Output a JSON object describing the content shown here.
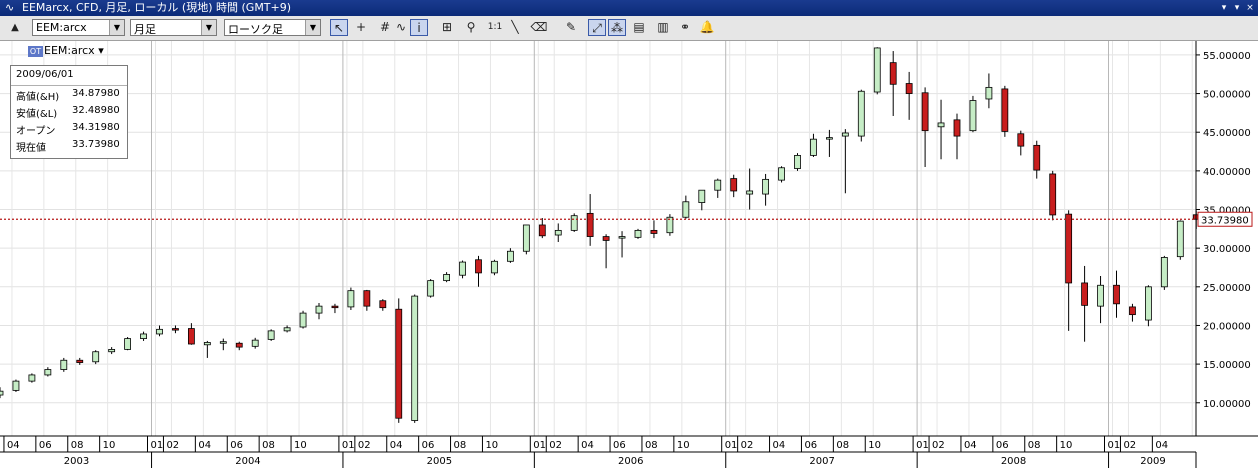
{
  "window": {
    "title": "EEMarcx, CFD, 月足, ローカル (現地) 時間 (GMT+9)",
    "controls": [
      "▾",
      "▾",
      "×"
    ]
  },
  "toolbar": {
    "symbol_combo": "EEM:arcx",
    "timeframe_combo": "月足",
    "charttype_combo": "ローソク足",
    "tools": [
      {
        "name": "cursor-tool-button",
        "glyph": "↖",
        "active": true
      },
      {
        "name": "crosshair-tool-button",
        "glyph": "+",
        "active": false
      },
      {
        "name": "grid-tool-button",
        "glyph": "#",
        "active": false
      },
      {
        "name": "indicator-tool-button",
        "glyph": "∿",
        "active": false
      },
      {
        "name": "info-tool-button",
        "glyph": "i",
        "active": true
      },
      {
        "name": "data-window-button",
        "glyph": "⊞",
        "active": false
      },
      {
        "name": "zoom-tool-button",
        "glyph": "⚲",
        "active": false
      },
      {
        "name": "zoom-reset-button",
        "glyph": "1:1",
        "active": false
      },
      {
        "name": "line-tool-button",
        "glyph": "╲",
        "active": false
      },
      {
        "name": "eraser-tool-button",
        "glyph": "⌫",
        "active": false
      },
      {
        "name": "erase-all-button",
        "glyph": "✎",
        "active": false
      },
      {
        "name": "autoscale-button",
        "glyph": "⤢",
        "active": true
      },
      {
        "name": "compare-button",
        "glyph": "⁂",
        "active": true
      },
      {
        "name": "template-button",
        "glyph": "▤",
        "active": false
      },
      {
        "name": "export-button",
        "glyph": "▥",
        "active": false
      },
      {
        "name": "link-button",
        "glyph": "⚭",
        "active": false
      },
      {
        "name": "alert-button",
        "glyph": "🔔",
        "active": false
      }
    ]
  },
  "symbol_tag": "EEM:arcx",
  "info_box": {
    "date": "2009/06/01",
    "rows": [
      {
        "key": "高値(&H)",
        "value": "34.87980"
      },
      {
        "key": "安値(&L)",
        "value": "32.48980"
      },
      {
        "key": "オープン",
        "value": "34.31980"
      },
      {
        "key": "現在値",
        "value": "33.73980"
      }
    ]
  },
  "chart_data": {
    "type": "candlestick",
    "yticks": [
      "55.00000",
      "50.00000",
      "45.00000",
      "40.00000",
      "35.00000",
      "30.00000",
      "25.00000",
      "20.00000",
      "15.00000",
      "10.00000"
    ],
    "ytick_values": [
      55,
      50,
      45,
      40,
      35,
      30,
      25,
      20,
      15,
      10
    ],
    "ylim": [
      5.7,
      56.8
    ],
    "current_price": 33.7398,
    "current_price_label": "33.73980",
    "month_labels": [
      "04",
      "06",
      "08",
      "10",
      "01",
      "02",
      "04",
      "06",
      "08",
      "10",
      "01",
      "02",
      "04",
      "06",
      "08",
      "10",
      "01",
      "02",
      "04",
      "06",
      "08",
      "10",
      "01",
      "02",
      "04",
      "06",
      "08",
      "10",
      "01",
      "02",
      "04",
      "06",
      "08",
      "10",
      "01",
      "02",
      "04"
    ],
    "year_labels": [
      "2003",
      "2004",
      "2005",
      "2006",
      "2007",
      "2008",
      "2009"
    ],
    "up_color": "#c6edc6",
    "down_color": "#c81e1e",
    "dates": [
      "2003-03",
      "2003-04",
      "2003-05",
      "2003-06",
      "2003-07",
      "2003-08",
      "2003-09",
      "2003-10",
      "2003-11",
      "2003-12",
      "2004-01",
      "2004-02",
      "2004-03",
      "2004-04",
      "2004-05",
      "2004-06",
      "2004-07",
      "2004-08",
      "2004-09",
      "2004-10",
      "2004-11",
      "2004-12",
      "2005-01",
      "2005-02",
      "2005-03",
      "2005-04",
      "2005-05",
      "2005-06",
      "2005-07",
      "2005-08",
      "2005-09",
      "2005-10",
      "2005-11",
      "2005-12",
      "2006-01",
      "2006-02",
      "2006-03",
      "2006-04",
      "2006-05",
      "2006-06",
      "2006-07",
      "2006-08",
      "2006-09",
      "2006-10",
      "2006-11",
      "2006-12",
      "2007-01",
      "2007-02",
      "2007-03",
      "2007-04",
      "2007-05",
      "2007-06",
      "2007-07",
      "2007-08",
      "2007-09",
      "2007-10",
      "2007-11",
      "2007-12",
      "2008-01",
      "2008-02",
      "2008-03",
      "2008-04",
      "2008-05",
      "2008-06",
      "2008-07",
      "2008-08",
      "2008-09",
      "2008-10",
      "2008-11",
      "2008-12",
      "2009-01",
      "2009-02",
      "2009-03",
      "2009-04",
      "2009-05",
      "2009-06"
    ],
    "ohlc": [
      [
        11.0,
        12.0,
        10.6,
        11.5
      ],
      [
        11.6,
        13.0,
        11.4,
        12.8
      ],
      [
        12.8,
        13.8,
        12.6,
        13.6
      ],
      [
        13.6,
        14.6,
        13.4,
        14.3
      ],
      [
        14.3,
        15.8,
        14.0,
        15.5
      ],
      [
        15.5,
        15.8,
        14.9,
        15.2
      ],
      [
        15.3,
        16.8,
        15.0,
        16.6
      ],
      [
        16.6,
        17.2,
        16.3,
        16.9
      ],
      [
        16.9,
        18.5,
        16.8,
        18.3
      ],
      [
        18.3,
        19.2,
        18.0,
        18.9
      ],
      [
        18.9,
        20.0,
        18.6,
        19.5
      ],
      [
        19.6,
        20.0,
        19.0,
        19.4
      ],
      [
        19.6,
        20.3,
        17.5,
        17.6
      ],
      [
        17.5,
        18.0,
        15.8,
        17.8
      ],
      [
        17.7,
        18.3,
        16.8,
        17.9
      ],
      [
        17.7,
        17.9,
        16.8,
        17.2
      ],
      [
        17.3,
        18.4,
        17.0,
        18.1
      ],
      [
        18.2,
        19.5,
        18.0,
        19.3
      ],
      [
        19.3,
        20.0,
        19.1,
        19.7
      ],
      [
        19.8,
        21.9,
        19.6,
        21.6
      ],
      [
        21.6,
        22.9,
        20.8,
        22.5
      ],
      [
        22.5,
        22.8,
        21.6,
        22.3
      ],
      [
        22.4,
        24.9,
        22.0,
        24.5
      ],
      [
        24.5,
        24.6,
        21.9,
        22.5
      ],
      [
        23.2,
        23.4,
        21.9,
        22.3
      ],
      [
        22.1,
        23.5,
        7.4,
        8.0
      ],
      [
        7.7,
        24.0,
        7.4,
        23.8
      ],
      [
        23.8,
        26.0,
        23.6,
        25.8
      ],
      [
        25.8,
        26.9,
        25.6,
        26.6
      ],
      [
        26.5,
        28.4,
        26.1,
        28.2
      ],
      [
        28.5,
        29.0,
        25.0,
        26.8
      ],
      [
        26.8,
        28.5,
        26.5,
        28.3
      ],
      [
        28.3,
        30.0,
        28.1,
        29.6
      ],
      [
        29.6,
        33.0,
        29.2,
        33.0
      ],
      [
        33.0,
        33.9,
        31.3,
        31.6
      ],
      [
        31.7,
        33.2,
        30.8,
        32.3
      ],
      [
        32.3,
        34.5,
        32.1,
        34.2
      ],
      [
        34.5,
        37.0,
        30.3,
        31.5
      ],
      [
        31.5,
        31.8,
        27.4,
        31.0
      ],
      [
        31.3,
        32.2,
        28.8,
        31.5
      ],
      [
        31.4,
        32.5,
        31.2,
        32.3
      ],
      [
        32.3,
        33.6,
        31.3,
        31.9
      ],
      [
        32.0,
        34.4,
        31.6,
        34.0
      ],
      [
        34.0,
        36.8,
        33.8,
        36.0
      ],
      [
        35.9,
        37.1,
        34.9,
        37.5
      ],
      [
        37.5,
        39.0,
        36.5,
        38.8
      ],
      [
        39.0,
        39.5,
        36.6,
        37.4
      ],
      [
        37.0,
        40.3,
        35.0,
        37.4
      ],
      [
        37.0,
        39.6,
        35.5,
        38.9
      ],
      [
        38.8,
        40.6,
        38.5,
        40.4
      ],
      [
        40.3,
        42.3,
        40.0,
        42.0
      ],
      [
        42.0,
        44.8,
        41.8,
        44.1
      ],
      [
        44.2,
        45.3,
        41.8,
        44.3
      ],
      [
        44.5,
        45.4,
        37.1,
        44.9
      ],
      [
        44.5,
        50.5,
        43.8,
        50.3
      ],
      [
        50.2,
        56.0,
        49.9,
        55.9
      ],
      [
        54.0,
        55.5,
        47.1,
        51.2
      ],
      [
        51.3,
        52.8,
        46.6,
        50.0
      ],
      [
        50.1,
        50.8,
        40.5,
        45.2
      ],
      [
        45.7,
        49.2,
        41.5,
        46.2
      ],
      [
        46.6,
        47.4,
        41.5,
        44.5
      ],
      [
        45.2,
        49.7,
        45.0,
        49.1
      ],
      [
        49.3,
        52.6,
        48.1,
        50.8
      ],
      [
        50.6,
        51.0,
        44.4,
        45.1
      ],
      [
        44.8,
        45.2,
        42.0,
        43.2
      ],
      [
        43.3,
        43.9,
        39.0,
        40.1
      ],
      [
        39.6,
        40.0,
        33.6,
        34.3
      ],
      [
        34.4,
        34.9,
        19.3,
        25.5
      ],
      [
        25.5,
        27.7,
        17.9,
        22.6
      ],
      [
        22.5,
        26.4,
        20.3,
        25.2
      ],
      [
        25.2,
        27.1,
        21.0,
        22.8
      ],
      [
        22.4,
        22.8,
        20.5,
        21.4
      ],
      [
        20.7,
        25.2,
        19.9,
        25.0
      ],
      [
        25.0,
        29.0,
        24.6,
        28.8
      ],
      [
        28.9,
        33.6,
        28.5,
        33.5
      ],
      [
        34.3198,
        34.8798,
        32.4898,
        33.7398
      ]
    ]
  }
}
